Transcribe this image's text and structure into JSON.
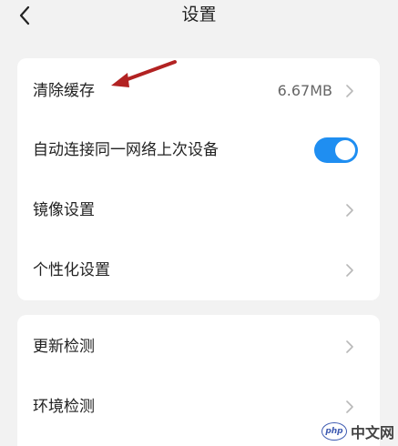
{
  "header": {
    "title": "设置",
    "back_icon": "chevron-left-icon"
  },
  "card_general": {
    "clear_cache": {
      "label": "清除缓存",
      "value": "6.67MB"
    },
    "auto_connect": {
      "label": "自动连接同一网络上次设备",
      "enabled": true
    },
    "mirror_settings": {
      "label": "镜像设置"
    },
    "personalization": {
      "label": "个性化设置"
    }
  },
  "card_check": {
    "update_check": {
      "label": "更新检测"
    },
    "environment_check": {
      "label": "环境检测"
    }
  },
  "watermark": {
    "logo_text": "php",
    "text": "中文网"
  },
  "colors": {
    "background": "#f2f2f2",
    "card": "#ffffff",
    "toggle_on": "#1f8ef1",
    "annotation_arrow": "#b22222"
  }
}
